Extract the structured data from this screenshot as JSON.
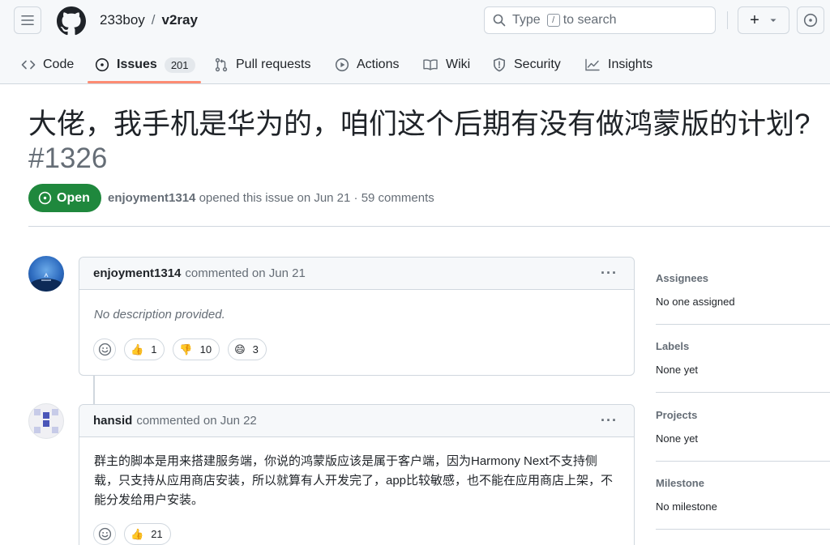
{
  "header": {
    "owner": "233boy",
    "separator": "/",
    "repo": "v2ray",
    "search": {
      "prefix": "Type",
      "key": "/",
      "suffix": "to search"
    },
    "plus": "+"
  },
  "tabs": [
    {
      "label": "Code"
    },
    {
      "label": "Issues",
      "count": "201"
    },
    {
      "label": "Pull requests"
    },
    {
      "label": "Actions"
    },
    {
      "label": "Wiki"
    },
    {
      "label": "Security"
    },
    {
      "label": "Insights"
    }
  ],
  "issue": {
    "title": "大佬，我手机是华为的，咱们这个后期有没有做鸿蒙版的计划?",
    "number": "#1326",
    "state": "Open",
    "author": "enjoyment1314",
    "meta_text": "opened this issue on Jun 21 · 59 comments"
  },
  "comments": [
    {
      "author": "enjoyment1314",
      "action": "commented on Jun 21",
      "body": "No description provided.",
      "reactions": [
        {
          "emoji": "👍",
          "count": "1"
        },
        {
          "emoji": "👎",
          "count": "10"
        },
        {
          "emoji": "😄",
          "count": "3"
        }
      ]
    },
    {
      "author": "hansid",
      "action": "commented on Jun 22",
      "body": "群主的脚本是用来搭建服务端，你说的鸿蒙版应该是属于客户端，因为Harmony Next不支持侧载，只支持从应用商店安装，所以就算有人开发完了，app比较敏感，也不能在应用商店上架，不能分发给用户安装。",
      "reactions": [
        {
          "emoji": "👍",
          "count": "21"
        }
      ]
    }
  ],
  "sidebar": [
    {
      "label": "Assignees",
      "value": "No one assigned"
    },
    {
      "label": "Labels",
      "value": "None yet"
    },
    {
      "label": "Projects",
      "value": "None yet"
    },
    {
      "label": "Milestone",
      "value": "No milestone"
    }
  ],
  "colors": {
    "open_green": "#1f883d",
    "tab_underline": "#fd8c73",
    "border": "#d0d7de",
    "muted": "#656d76"
  }
}
